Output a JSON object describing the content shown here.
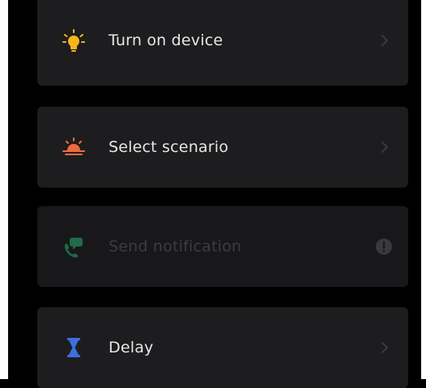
{
  "actions": [
    {
      "label": "Turn on device",
      "icon": "lightbulb-icon",
      "color": "#f5b51b",
      "enabled": true
    },
    {
      "label": "Select scenario",
      "icon": "sunrise-icon",
      "color": "#f06a3c",
      "enabled": true
    },
    {
      "label": "Send notification",
      "icon": "phone-notification-icon",
      "color": "#1f6b4a",
      "enabled": false
    },
    {
      "label": "Delay",
      "icon": "hourglass-icon",
      "color": "#3d6fe0",
      "enabled": true
    }
  ]
}
